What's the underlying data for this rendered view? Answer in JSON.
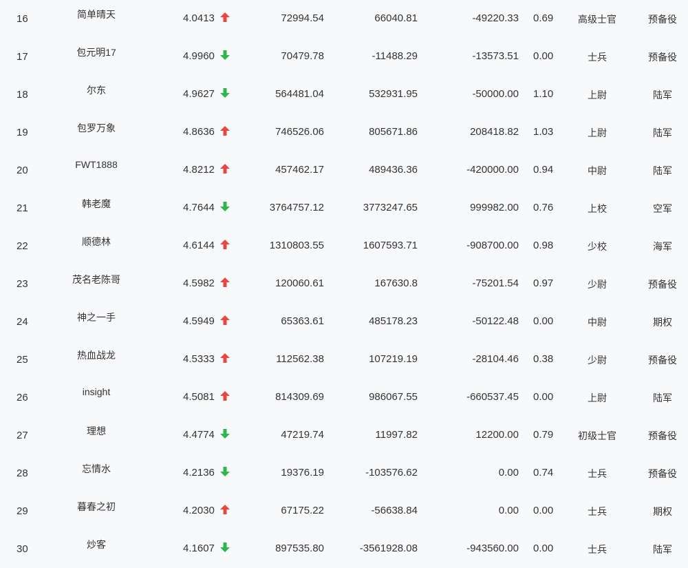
{
  "colors": {
    "up": "#e8473f",
    "down": "#2fb54a",
    "text": "#333333",
    "background": "#f8f9fb"
  },
  "rows": [
    {
      "rank": "16",
      "name": "简单晴天",
      "score": "4.0413",
      "trend": "up",
      "c1": "72994.54",
      "c2": "66040.81",
      "c3": "-49220.33",
      "c4": "0.69",
      "title": "高级士官",
      "branch": "预备役"
    },
    {
      "rank": "17",
      "name": "包元明17",
      "score": "4.9960",
      "trend": "down",
      "c1": "70479.78",
      "c2": "-11488.29",
      "c3": "-13573.51",
      "c4": "0.00",
      "title": "士兵",
      "branch": "预备役"
    },
    {
      "rank": "18",
      "name": "尔东",
      "score": "4.9627",
      "trend": "down",
      "c1": "564481.04",
      "c2": "532931.95",
      "c3": "-50000.00",
      "c4": "1.10",
      "title": "上尉",
      "branch": "陆军"
    },
    {
      "rank": "19",
      "name": "包罗万象",
      "score": "4.8636",
      "trend": "up",
      "c1": "746526.06",
      "c2": "805671.86",
      "c3": "208418.82",
      "c4": "1.03",
      "title": "上尉",
      "branch": "陆军"
    },
    {
      "rank": "20",
      "name": "FWT1888",
      "score": "4.8212",
      "trend": "up",
      "c1": "457462.17",
      "c2": "489436.36",
      "c3": "-420000.00",
      "c4": "0.94",
      "title": "中尉",
      "branch": "陆军"
    },
    {
      "rank": "21",
      "name": "韩老魔",
      "score": "4.7644",
      "trend": "down",
      "c1": "3764757.12",
      "c2": "3773247.65",
      "c3": "999982.00",
      "c4": "0.76",
      "title": "上校",
      "branch": "空军"
    },
    {
      "rank": "22",
      "name": "顺德林",
      "score": "4.6144",
      "trend": "up",
      "c1": "1310803.55",
      "c2": "1607593.71",
      "c3": "-908700.00",
      "c4": "0.98",
      "title": "少校",
      "branch": "海军"
    },
    {
      "rank": "23",
      "name": "茂名老陈哥",
      "score": "4.5982",
      "trend": "up",
      "c1": "120060.61",
      "c2": "167630.8",
      "c3": "-75201.54",
      "c4": "0.97",
      "title": "少尉",
      "branch": "预备役"
    },
    {
      "rank": "24",
      "name": "神之一手",
      "score": "4.5949",
      "trend": "up",
      "c1": "65363.61",
      "c2": "485178.23",
      "c3": "-50122.48",
      "c4": "0.00",
      "title": "中尉",
      "branch": "期权"
    },
    {
      "rank": "25",
      "name": "热血战龙",
      "score": "4.5333",
      "trend": "up",
      "c1": "112562.38",
      "c2": "107219.19",
      "c3": "-28104.46",
      "c4": "0.38",
      "title": "少尉",
      "branch": "预备役"
    },
    {
      "rank": "26",
      "name": "insight",
      "score": "4.5081",
      "trend": "up",
      "c1": "814309.69",
      "c2": "986067.55",
      "c3": "-660537.45",
      "c4": "0.00",
      "title": "上尉",
      "branch": "陆军"
    },
    {
      "rank": "27",
      "name": "理想",
      "score": "4.4774",
      "trend": "down",
      "c1": "47219.74",
      "c2": "11997.82",
      "c3": "12200.00",
      "c4": "0.79",
      "title": "初级士官",
      "branch": "预备役"
    },
    {
      "rank": "28",
      "name": "忘情水",
      "score": "4.2136",
      "trend": "down",
      "c1": "19376.19",
      "c2": "-103576.62",
      "c3": "0.00",
      "c4": "0.74",
      "title": "士兵",
      "branch": "预备役"
    },
    {
      "rank": "29",
      "name": "暮春之初",
      "score": "4.2030",
      "trend": "up",
      "c1": "67175.22",
      "c2": "-56638.84",
      "c3": "0.00",
      "c4": "0.00",
      "title": "士兵",
      "branch": "期权"
    },
    {
      "rank": "30",
      "name": "炒客",
      "score": "4.1607",
      "trend": "down",
      "c1": "897535.80",
      "c2": "-3561928.08",
      "c3": "-943560.00",
      "c4": "0.00",
      "title": "士兵",
      "branch": "陆军"
    }
  ]
}
